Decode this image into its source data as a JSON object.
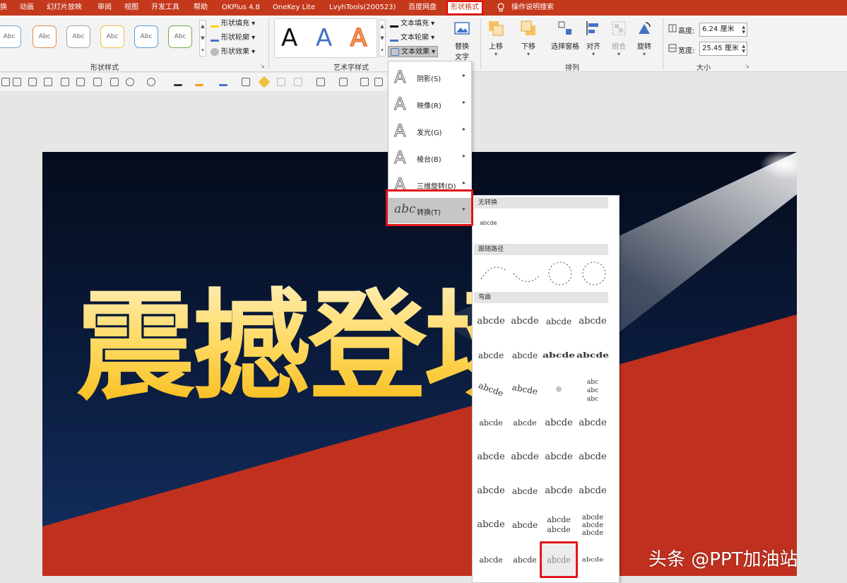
{
  "menubar": {
    "items": [
      "换",
      "动画",
      "幻灯片放映",
      "审阅",
      "视图",
      "开发工具",
      "帮助",
      "OKPlus 4.8",
      "OneKey Lite",
      "LvyhTools(200523)",
      "百度网盘"
    ],
    "active_tab": "形状格式",
    "search_hint": "操作说明搜索"
  },
  "ribbon": {
    "shape_styles": {
      "swatch_label": "Abc",
      "fill": "形状填充",
      "outline": "形状轮廓",
      "effects": "形状效果",
      "group_label": "形状样式"
    },
    "art_styles": {
      "glyph": "A",
      "text_fill": "文本填充",
      "text_outline": "文本轮廓",
      "text_effects": "文本效果",
      "group_label": "艺术字样式"
    },
    "alt_text": {
      "line1": "替换",
      "line2": "文字"
    },
    "arrange": {
      "bring_forward": "上移",
      "send_backward": "下移",
      "selection_pane": "选择窗格",
      "align": "对齐",
      "group": "组合",
      "rotate": "旋转",
      "group_label": "排列"
    },
    "size": {
      "height_label": "高度:",
      "height_value": "6.24 厘米",
      "width_label": "宽度:",
      "width_value": "25.45 厘米",
      "group_label": "大小"
    }
  },
  "slide": {
    "title": "震撼登场!"
  },
  "effects_menu": {
    "items": [
      {
        "label": "阴影(S)"
      },
      {
        "label": "映像(R)"
      },
      {
        "label": "发光(G)"
      },
      {
        "label": "棱台(B)"
      },
      {
        "label": "三维旋转(D)"
      },
      {
        "label": "转换(T)",
        "icon_text": "abc"
      }
    ]
  },
  "transform_gallery": {
    "sections": {
      "none": "无转换",
      "follow_path": "跟随路径",
      "warp": "弯曲"
    },
    "sample": "abcde"
  },
  "watermark": "头条 @PPT加油站",
  "colors": {
    "accent_red": "#c4381c",
    "highlight": "#e0161b",
    "slide_red": "#c0301f",
    "slide_navy": "#0a1a3a"
  }
}
